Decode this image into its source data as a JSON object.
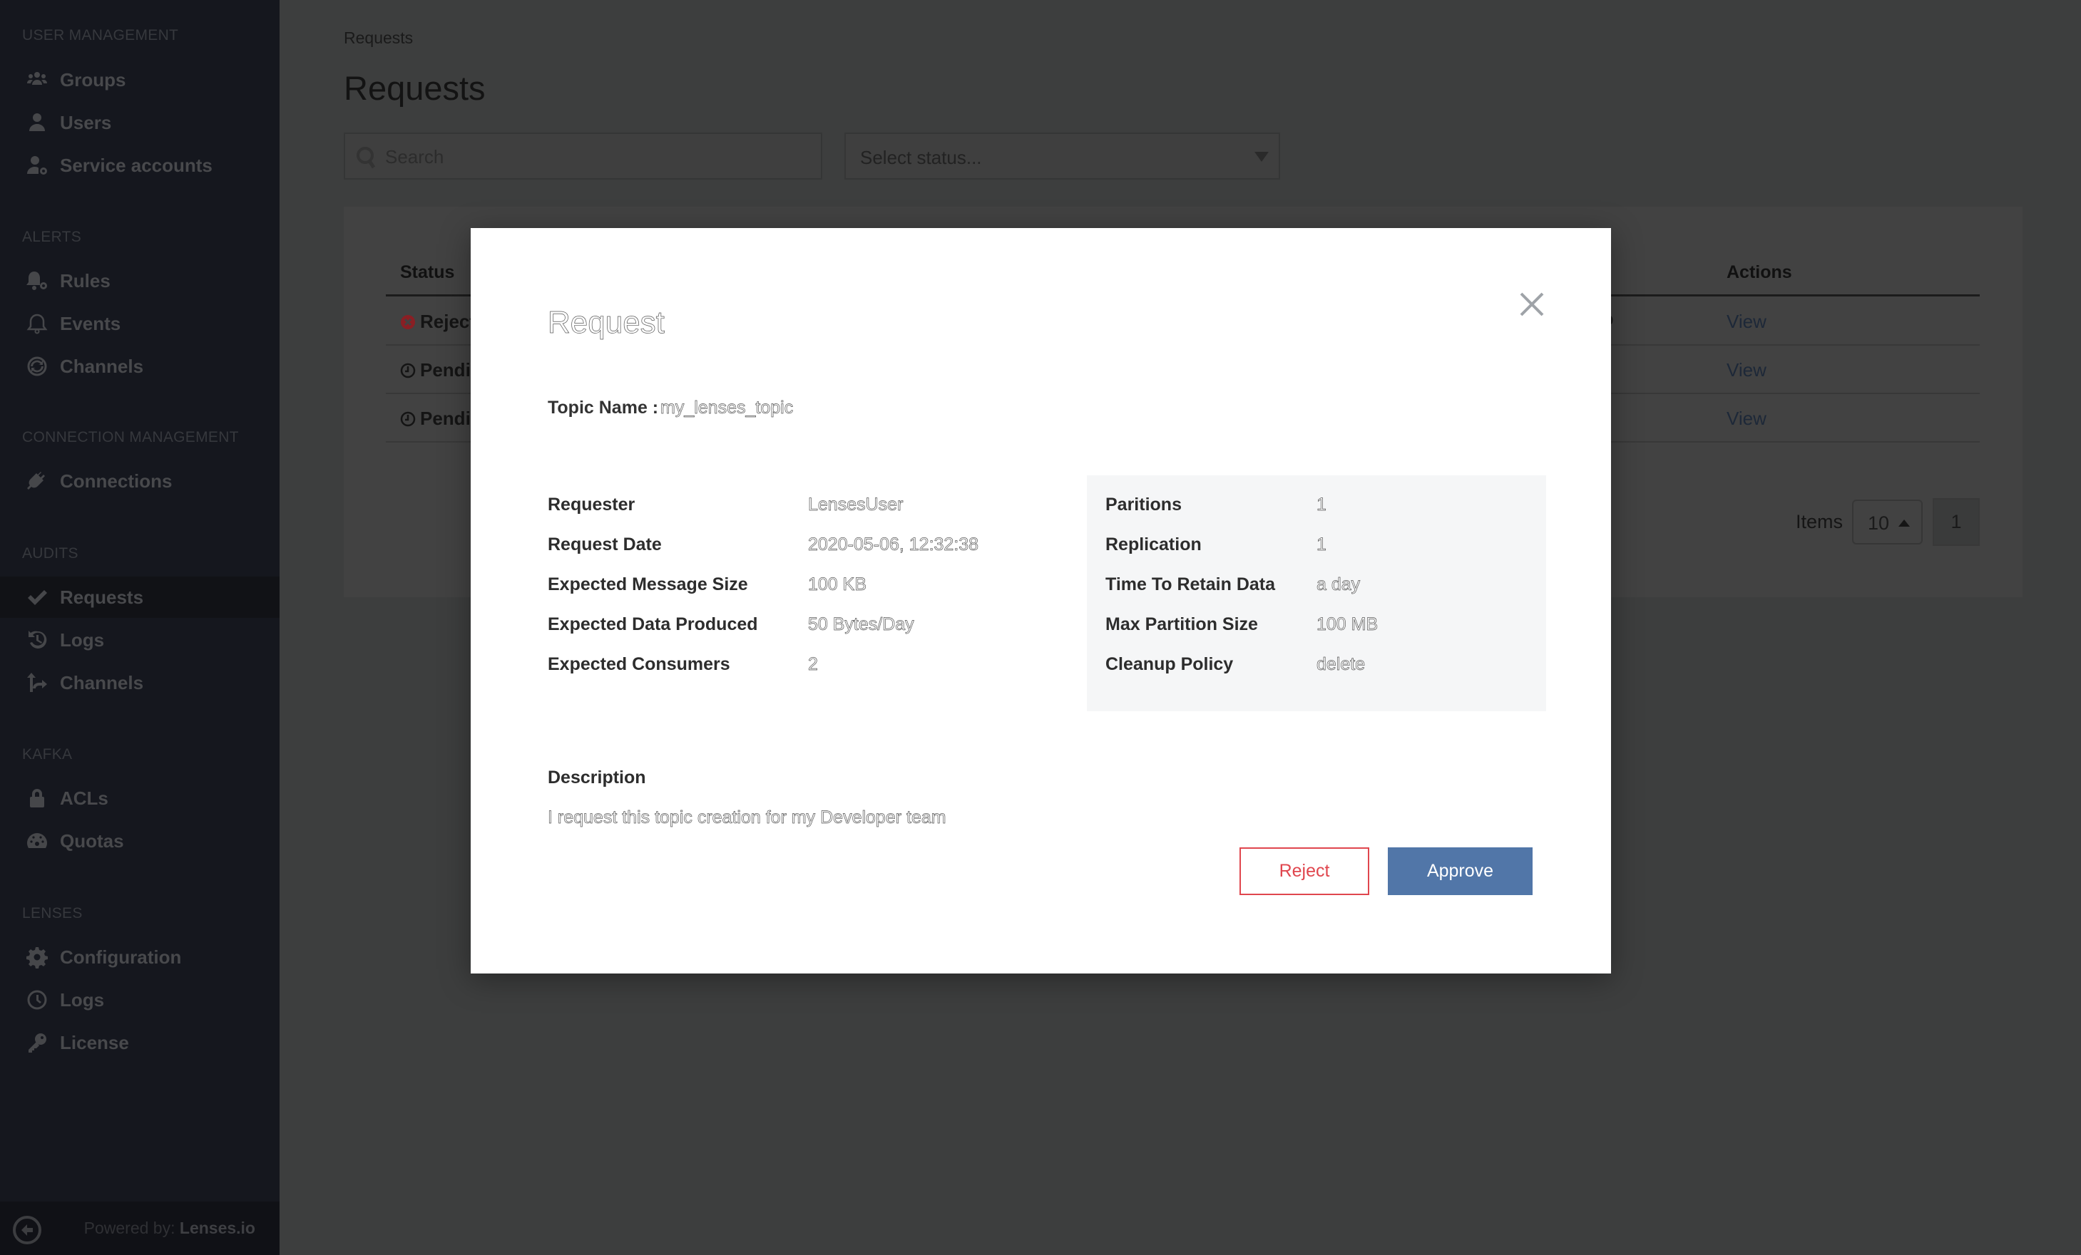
{
  "sidebar": {
    "sections": [
      {
        "label": "USER MANAGEMENT",
        "items": [
          {
            "label": "Groups",
            "icon": "users-group-icon"
          },
          {
            "label": "Users",
            "icon": "user-icon"
          },
          {
            "label": "Service accounts",
            "icon": "user-cog-icon"
          }
        ]
      },
      {
        "label": "ALERTS",
        "items": [
          {
            "label": "Rules",
            "icon": "bell-cog-icon"
          },
          {
            "label": "Events",
            "icon": "bell-outline-icon"
          },
          {
            "label": "Channels",
            "icon": "sync-channels-icon"
          }
        ]
      },
      {
        "label": "CONNECTION MANAGEMENT",
        "items": [
          {
            "label": "Connections",
            "icon": "plug-icon"
          }
        ]
      },
      {
        "label": "AUDITS",
        "items": [
          {
            "label": "Requests",
            "icon": "check-icon",
            "active": true
          },
          {
            "label": "Logs",
            "icon": "history-icon"
          },
          {
            "label": "Channels",
            "icon": "split-arrow-icon"
          }
        ]
      },
      {
        "label": "KAFKA",
        "items": [
          {
            "label": "ACLs",
            "icon": "lock-icon"
          },
          {
            "label": "Quotas",
            "icon": "gauge-icon"
          }
        ]
      },
      {
        "label": "LENSES",
        "items": [
          {
            "label": "Configuration",
            "icon": "gear-icon"
          },
          {
            "label": "Logs",
            "icon": "clock-icon"
          },
          {
            "label": "License",
            "icon": "key-icon"
          }
        ]
      }
    ],
    "footer": {
      "powered_prefix": "Powered by:",
      "powered_brand": "Lenses.io"
    }
  },
  "page": {
    "breadcrumb": "Requests",
    "title": "Requests",
    "search": {
      "placeholder": "Search",
      "value": ""
    },
    "status_select": {
      "placeholder": "Select status..."
    }
  },
  "table": {
    "headers": {
      "status": "Status",
      "actions": "Actions"
    },
    "rows": [
      {
        "status": "Rejected",
        "status_visible": "Reject",
        "status_icon": "rejected-circle-icon",
        "partial_text": "o",
        "action": "View"
      },
      {
        "status": "Pending",
        "status_visible": "Pendi",
        "status_icon": "clock-icon",
        "partial_text": "",
        "action": "View"
      },
      {
        "status": "Pending",
        "status_visible": "Pendi",
        "status_icon": "clock-icon",
        "partial_text": "",
        "action": "View"
      }
    ],
    "pagination": {
      "items_label": "Items",
      "page_size": "10",
      "current_page": "1"
    }
  },
  "modal": {
    "title": "Request",
    "topic_label": "Topic Name :",
    "topic_value": "my_lenses_topic",
    "left_details": [
      {
        "label": "Requester",
        "value": "LensesUser"
      },
      {
        "label": "Request Date",
        "value": "2020-05-06, 12:32:38"
      },
      {
        "label": "Expected Message Size",
        "value": "100 KB"
      },
      {
        "label": "Expected Data Produced",
        "value": "50 Bytes/Day"
      },
      {
        "label": "Expected Consumers",
        "value": "2"
      }
    ],
    "right_details": [
      {
        "label": "Paritions",
        "value": "1"
      },
      {
        "label": "Replication",
        "value": "1"
      },
      {
        "label": "Time To Retain Data",
        "value": "a day"
      },
      {
        "label": "Max Partition Size",
        "value": "100 MB"
      },
      {
        "label": "Cleanup Policy",
        "value": "delete"
      }
    ],
    "description_label": "Description",
    "description_value": "I request this topic creation for my Developer team",
    "reject_label": "Reject",
    "approve_label": "Approve"
  },
  "colors": {
    "reject": "#e0464e",
    "approve": "#5176a8",
    "rejected_status": "#8a1f24"
  }
}
